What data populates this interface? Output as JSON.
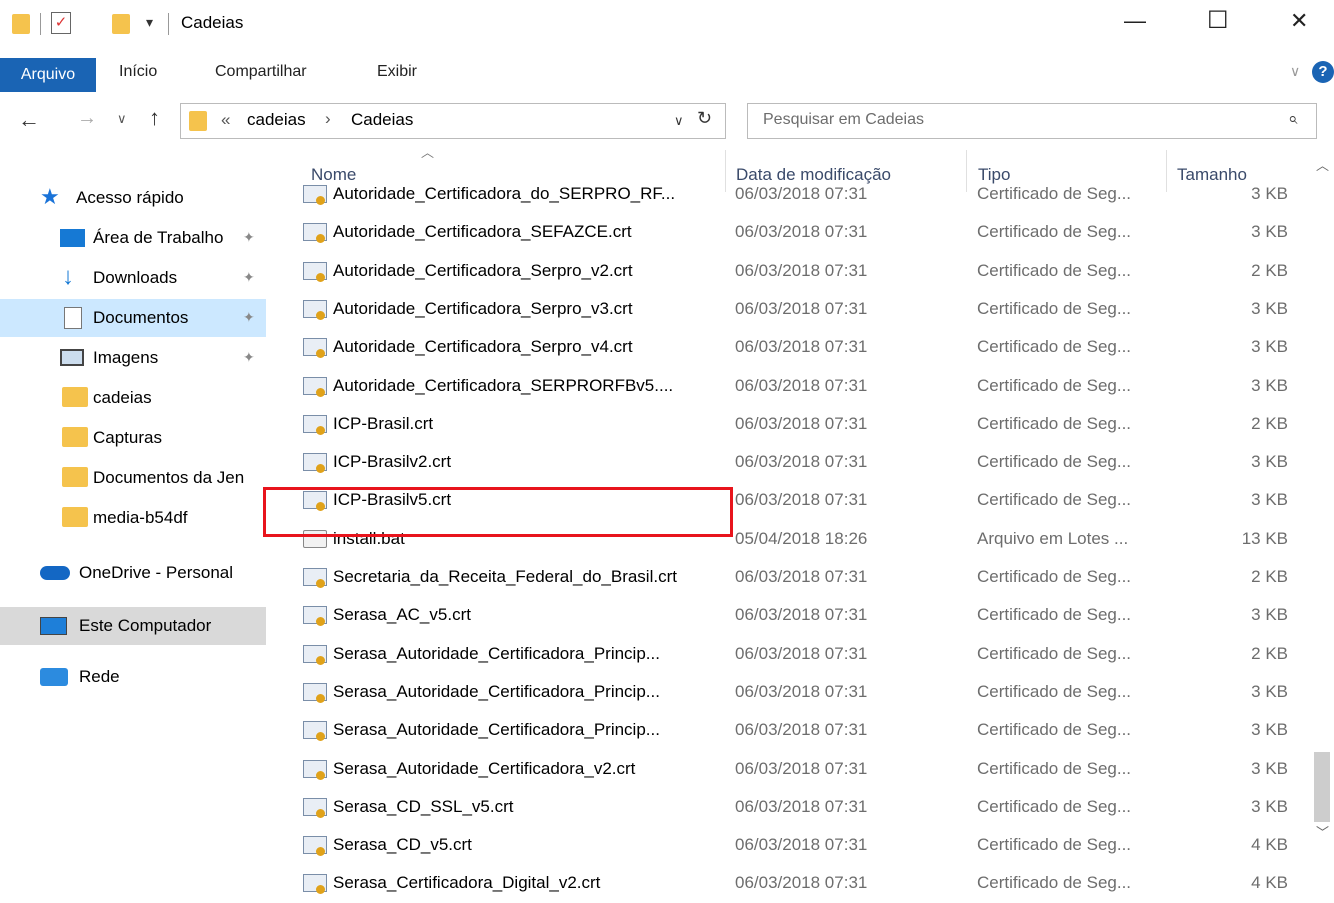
{
  "window": {
    "title": "Cadeias",
    "minimize": "—",
    "maximize": "☐",
    "close": "✕"
  },
  "ribbon": {
    "tabs": [
      "Arquivo",
      "Início",
      "Compartilhar",
      "Exibir"
    ],
    "help": "?"
  },
  "address": {
    "overflow": "«",
    "crumbs": [
      "cadeias",
      "Cadeias"
    ],
    "separator": "›",
    "search_placeholder": "Pesquisar em Cadeias"
  },
  "sidebar": {
    "items": [
      {
        "label": "Acesso rápido",
        "icon": "star-icon",
        "pinned": false
      },
      {
        "label": "Área de Trabalho",
        "icon": "desktop-icon",
        "pinned": true
      },
      {
        "label": "Downloads",
        "icon": "download-icon",
        "pinned": true
      },
      {
        "label": "Documentos",
        "icon": "document-icon",
        "pinned": true
      },
      {
        "label": "Imagens",
        "icon": "image-icon",
        "pinned": true
      },
      {
        "label": "cadeias",
        "icon": "folder-icon",
        "pinned": false
      },
      {
        "label": "Capturas",
        "icon": "folder-icon",
        "pinned": false
      },
      {
        "label": "Documentos da Jen",
        "icon": "folder-icon",
        "pinned": false
      },
      {
        "label": "media-b54df",
        "icon": "folder-icon",
        "pinned": false
      },
      {
        "label": "OneDrive - Personal",
        "icon": "cloud-icon",
        "pinned": false
      },
      {
        "label": "Este Computador",
        "icon": "computer-icon",
        "pinned": false
      },
      {
        "label": "Rede",
        "icon": "network-icon",
        "pinned": false
      }
    ]
  },
  "columns": {
    "name": "Nome",
    "date": "Data de modificação",
    "type": "Tipo",
    "size": "Tamanho"
  },
  "files": [
    {
      "name": "Autoridade_Certificadora_do_SERPRO_RF...",
      "date": "06/03/2018 07:31",
      "type": "Certificado de Seg...",
      "size": "3 KB",
      "icon": "certificate-icon"
    },
    {
      "name": "Autoridade_Certificadora_SEFAZCE.crt",
      "date": "06/03/2018 07:31",
      "type": "Certificado de Seg...",
      "size": "3 KB",
      "icon": "certificate-icon"
    },
    {
      "name": "Autoridade_Certificadora_Serpro_v2.crt",
      "date": "06/03/2018 07:31",
      "type": "Certificado de Seg...",
      "size": "2 KB",
      "icon": "certificate-icon"
    },
    {
      "name": "Autoridade_Certificadora_Serpro_v3.crt",
      "date": "06/03/2018 07:31",
      "type": "Certificado de Seg...",
      "size": "3 KB",
      "icon": "certificate-icon"
    },
    {
      "name": "Autoridade_Certificadora_Serpro_v4.crt",
      "date": "06/03/2018 07:31",
      "type": "Certificado de Seg...",
      "size": "3 KB",
      "icon": "certificate-icon"
    },
    {
      "name": "Autoridade_Certificadora_SERPRORFBv5....",
      "date": "06/03/2018 07:31",
      "type": "Certificado de Seg...",
      "size": "3 KB",
      "icon": "certificate-icon"
    },
    {
      "name": "ICP-Brasil.crt",
      "date": "06/03/2018 07:31",
      "type": "Certificado de Seg...",
      "size": "2 KB",
      "icon": "certificate-icon"
    },
    {
      "name": "ICP-Brasilv2.crt",
      "date": "06/03/2018 07:31",
      "type": "Certificado de Seg...",
      "size": "3 KB",
      "icon": "certificate-icon"
    },
    {
      "name": "ICP-Brasilv5.crt",
      "date": "06/03/2018 07:31",
      "type": "Certificado de Seg...",
      "size": "3 KB",
      "icon": "certificate-icon"
    },
    {
      "name": "install.bat",
      "date": "05/04/2018 18:26",
      "type": "Arquivo em Lotes ...",
      "size": "13 KB",
      "icon": "batch-file-icon",
      "highlighted": true
    },
    {
      "name": "Secretaria_da_Receita_Federal_do_Brasil.crt",
      "date": "06/03/2018 07:31",
      "type": "Certificado de Seg...",
      "size": "2 KB",
      "icon": "certificate-icon"
    },
    {
      "name": "Serasa_AC_v5.crt",
      "date": "06/03/2018 07:31",
      "type": "Certificado de Seg...",
      "size": "3 KB",
      "icon": "certificate-icon"
    },
    {
      "name": "Serasa_Autoridade_Certificadora_Princip...",
      "date": "06/03/2018 07:31",
      "type": "Certificado de Seg...",
      "size": "2 KB",
      "icon": "certificate-icon"
    },
    {
      "name": "Serasa_Autoridade_Certificadora_Princip...",
      "date": "06/03/2018 07:31",
      "type": "Certificado de Seg...",
      "size": "3 KB",
      "icon": "certificate-icon"
    },
    {
      "name": "Serasa_Autoridade_Certificadora_Princip...",
      "date": "06/03/2018 07:31",
      "type": "Certificado de Seg...",
      "size": "3 KB",
      "icon": "certificate-icon"
    },
    {
      "name": "Serasa_Autoridade_Certificadora_v2.crt",
      "date": "06/03/2018 07:31",
      "type": "Certificado de Seg...",
      "size": "3 KB",
      "icon": "certificate-icon"
    },
    {
      "name": "Serasa_CD_SSL_v5.crt",
      "date": "06/03/2018 07:31",
      "type": "Certificado de Seg...",
      "size": "3 KB",
      "icon": "certificate-icon"
    },
    {
      "name": "Serasa_CD_v5.crt",
      "date": "06/03/2018 07:31",
      "type": "Certificado de Seg...",
      "size": "4 KB",
      "icon": "certificate-icon"
    },
    {
      "name": "Serasa_Certificadora_Digital_v2.crt",
      "date": "06/03/2018 07:31",
      "type": "Certificado de Seg...",
      "size": "4 KB",
      "icon": "certificate-icon"
    }
  ],
  "colors": {
    "accent": "#1a64b4",
    "highlight_box": "#e8141c",
    "selected_nav": "#cce8ff",
    "folder": "#f5c34d"
  }
}
